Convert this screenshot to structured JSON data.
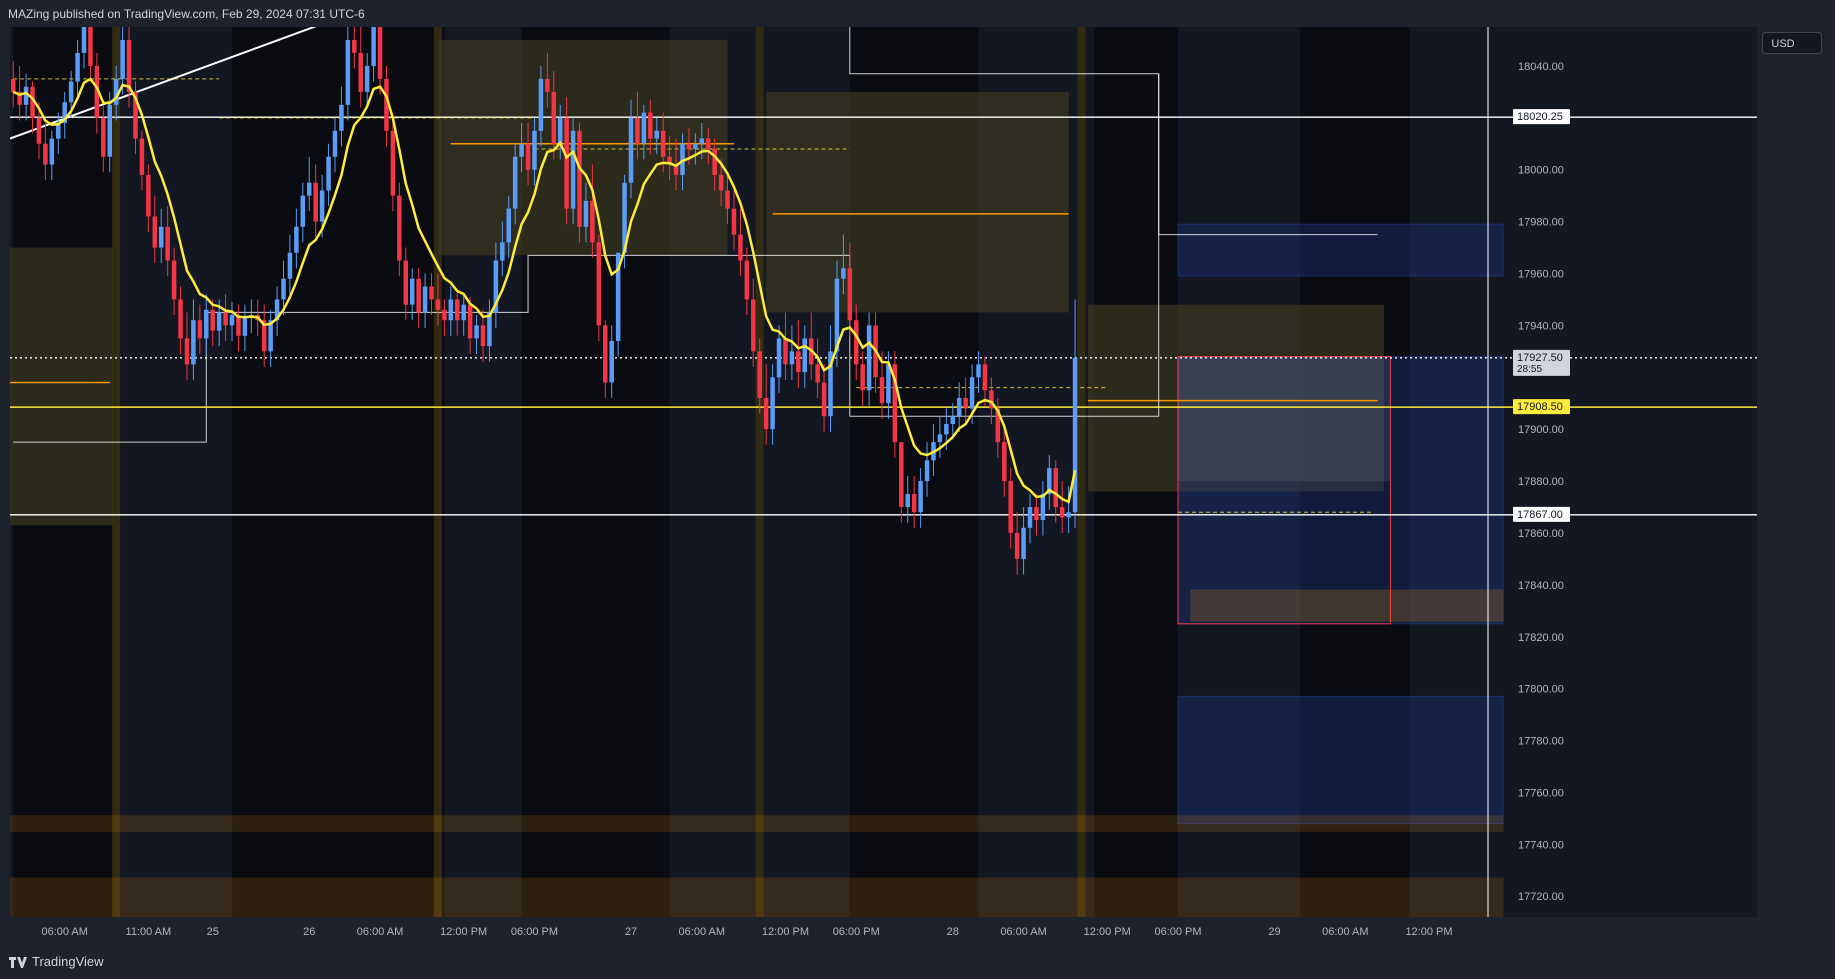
{
  "header": {
    "publish_line": "MAZing published on TradingView.com, Feb 29, 2024 07:31 UTC-6"
  },
  "footer": {
    "brand": "TradingView"
  },
  "currency_button": "USD",
  "colors": {
    "bull": "#5b9cf6",
    "bear": "#f23645",
    "ema": "#ffeb3b",
    "orange": "#ff9800",
    "zone_tan": "#3a3820",
    "session_band": "#3b3212",
    "blue_zone": "#1e3a8a",
    "bg": "#131722"
  },
  "chart_data": {
    "type": "candlestick",
    "symbol_currency": "USD",
    "ylim": [
      17712,
      18055
    ],
    "y_ticks": [
      18040,
      18020,
      18000,
      17980,
      17960,
      17940,
      17920,
      17900,
      17880,
      17860,
      17840,
      17820,
      17800,
      17780,
      17760,
      17740,
      17720
    ],
    "y_tick_labels": [
      "18040.00",
      "18000.00",
      "17980.00",
      "17960.00",
      "17940.00",
      "17900.00",
      "17880.00",
      "17860.00",
      "17840.00",
      "17820.00",
      "17800.00",
      "17780.00",
      "17760.00",
      "17740.00",
      "17720.00"
    ],
    "price_labels": [
      {
        "text": "18020.25",
        "value": 18020.25,
        "style": "white"
      },
      {
        "text": "17927.50",
        "sub": "28:55",
        "value": 17927.5,
        "style": "grey"
      },
      {
        "text": "17908.50",
        "value": 17908.5,
        "style": "yellow"
      },
      {
        "text": "17867.00",
        "value": 17867,
        "style": "white"
      }
    ],
    "x_labels": [
      "06:00 AM",
      "11:00 AM",
      "25",
      "26",
      "06:00 AM",
      "12:00 PM",
      "06:00 PM",
      "27",
      "06:00 AM",
      "12:00 PM",
      "06:00 PM",
      "28",
      "06:00 AM",
      "12:00 PM",
      "06:00 PM",
      "29",
      "06:00 AM",
      "12:00 PM"
    ],
    "x_label_index": [
      8,
      21,
      31,
      46,
      57,
      70,
      81,
      96,
      107,
      120,
      131,
      146,
      157,
      170,
      181,
      196,
      207,
      220
    ],
    "x_count": 232,
    "bars": [
      {
        "o": 18035,
        "h": 18042,
        "c": 18030
      },
      {
        "o": 18030,
        "h": 18040,
        "c": 18025
      },
      {
        "o": 18025,
        "h": 18037,
        "c": 18032
      },
      {
        "o": 18032,
        "h": 18034,
        "c": 18020
      },
      {
        "o": 18020,
        "h": 18026,
        "c": 18010
      },
      {
        "o": 18010,
        "h": 18018,
        "c": 18002
      },
      {
        "o": 18002,
        "h": 18015,
        "c": 18012
      },
      {
        "o": 18012,
        "h": 18022,
        "c": 18018
      },
      {
        "o": 18018,
        "h": 18030,
        "c": 18026
      },
      {
        "o": 18026,
        "h": 18038,
        "c": 18034
      },
      {
        "o": 18034,
        "h": 18050,
        "c": 18045
      },
      {
        "o": 18045,
        "h": 18060,
        "c": 18055
      },
      {
        "o": 18055,
        "h": 18058,
        "c": 18040
      },
      {
        "o": 18040,
        "h": 18045,
        "c": 18020
      },
      {
        "o": 18020,
        "h": 18025,
        "c": 18005
      },
      {
        "o": 18005,
        "h": 18030,
        "c": 18025
      },
      {
        "o": 18025,
        "h": 18040,
        "c": 18035
      },
      {
        "o": 18035,
        "h": 18058,
        "c": 18050
      },
      {
        "o": 18050,
        "h": 18056,
        "c": 18030
      },
      {
        "o": 18030,
        "h": 18034,
        "c": 18012
      },
      {
        "o": 18012,
        "h": 18015,
        "c": 17998
      },
      {
        "o": 17998,
        "h": 18002,
        "c": 17982
      },
      {
        "o": 17982,
        "h": 17990,
        "c": 17970
      },
      {
        "o": 17970,
        "h": 17985,
        "c": 17978
      },
      {
        "o": 17978,
        "h": 17986,
        "c": 17965
      },
      {
        "o": 17965,
        "h": 17970,
        "c": 17950
      },
      {
        "o": 17950,
        "h": 17955,
        "c": 17935
      },
      {
        "o": 17935,
        "h": 17945,
        "c": 17925
      },
      {
        "o": 17925,
        "h": 17950,
        "c": 17942
      },
      {
        "o": 17942,
        "h": 17948,
        "c": 17935
      },
      {
        "o": 17935,
        "h": 17952,
        "c": 17946
      },
      {
        "o": 17946,
        "h": 17950,
        "c": 17938
      },
      {
        "o": 17938,
        "h": 17950,
        "c": 17945
      },
      {
        "o": 17945,
        "h": 17952,
        "c": 17940
      },
      {
        "o": 17940,
        "h": 17949,
        "c": 17944
      },
      {
        "o": 17944,
        "h": 17948,
        "c": 17936
      },
      {
        "o": 17936,
        "h": 17948,
        "c": 17943
      },
      {
        "o": 17943,
        "h": 17950,
        "c": 17944
      },
      {
        "o": 17944,
        "h": 17950,
        "c": 17942
      },
      {
        "o": 17942,
        "h": 17948,
        "c": 17930
      },
      {
        "o": 17930,
        "h": 17946,
        "c": 17942
      },
      {
        "o": 17942,
        "h": 17955,
        "c": 17950
      },
      {
        "o": 17950,
        "h": 17965,
        "c": 17958
      },
      {
        "o": 17958,
        "h": 17975,
        "c": 17968
      },
      {
        "o": 17968,
        "h": 17985,
        "c": 17978
      },
      {
        "o": 17978,
        "h": 17995,
        "c": 17990
      },
      {
        "o": 17990,
        "h": 18005,
        "c": 17995
      },
      {
        "o": 17995,
        "h": 18002,
        "c": 17980
      },
      {
        "o": 17980,
        "h": 17998,
        "c": 17992
      },
      {
        "o": 17992,
        "h": 18010,
        "c": 18005
      },
      {
        "o": 18005,
        "h": 18020,
        "c": 18015
      },
      {
        "o": 18015,
        "h": 18032,
        "c": 18025
      },
      {
        "o": 18025,
        "h": 18055,
        "c": 18050
      },
      {
        "o": 18050,
        "h": 18062,
        "c": 18045
      },
      {
        "o": 18045,
        "h": 18058,
        "c": 18030
      },
      {
        "o": 18030,
        "h": 18045,
        "c": 18040
      },
      {
        "o": 18040,
        "h": 18062,
        "c": 18055
      },
      {
        "o": 18055,
        "h": 18062,
        "c": 18035
      },
      {
        "o": 18035,
        "h": 18040,
        "c": 18015
      },
      {
        "o": 18015,
        "h": 18020,
        "c": 17990
      },
      {
        "o": 17990,
        "h": 17995,
        "c": 17965
      },
      {
        "o": 17965,
        "h": 17970,
        "c": 17948
      },
      {
        "o": 17948,
        "h": 17962,
        "c": 17958
      },
      {
        "o": 17958,
        "h": 17962,
        "c": 17945
      },
      {
        "o": 17945,
        "h": 17960,
        "c": 17955
      },
      {
        "o": 17955,
        "h": 17960,
        "c": 17950
      },
      {
        "o": 17950,
        "h": 17960,
        "c": 17946
      },
      {
        "o": 17946,
        "h": 17950,
        "c": 17942
      },
      {
        "o": 17942,
        "h": 17955,
        "c": 17950
      },
      {
        "o": 17950,
        "h": 17953,
        "c": 17942
      },
      {
        "o": 17942,
        "h": 17952,
        "c": 17948
      },
      {
        "o": 17948,
        "h": 17951,
        "c": 17935
      },
      {
        "o": 17935,
        "h": 17944,
        "c": 17940
      },
      {
        "o": 17940,
        "h": 17946,
        "c": 17932
      },
      {
        "o": 17932,
        "h": 17950,
        "c": 17945
      },
      {
        "o": 17945,
        "h": 17972,
        "c": 17965
      },
      {
        "o": 17965,
        "h": 17980,
        "c": 17972
      },
      {
        "o": 17972,
        "h": 17990,
        "c": 17985
      },
      {
        "o": 17985,
        "h": 18010,
        "c": 18005
      },
      {
        "o": 18005,
        "h": 18018,
        "c": 18010
      },
      {
        "o": 18010,
        "h": 18018,
        "c": 18000
      },
      {
        "o": 18000,
        "h": 18020,
        "c": 18015
      },
      {
        "o": 18015,
        "h": 18040,
        "c": 18035
      },
      {
        "o": 18035,
        "h": 18045,
        "c": 18030
      },
      {
        "o": 18030,
        "h": 18038,
        "c": 18010
      },
      {
        "o": 18010,
        "h": 18025,
        "c": 18020
      },
      {
        "o": 18020,
        "h": 18028,
        "c": 17985
      },
      {
        "o": 17985,
        "h": 18020,
        "c": 18015
      },
      {
        "o": 18015,
        "h": 18018,
        "c": 17978
      },
      {
        "o": 17978,
        "h": 17995,
        "c": 17988
      },
      {
        "o": 17988,
        "h": 18002,
        "c": 17972
      },
      {
        "o": 17972,
        "h": 17975,
        "c": 17940
      },
      {
        "o": 17940,
        "h": 17942,
        "c": 17918
      },
      {
        "o": 17918,
        "h": 17940,
        "c": 17934
      },
      {
        "o": 17934,
        "h": 17960,
        "c": 17968
      },
      {
        "o": 17968,
        "h": 17998,
        "c": 17995
      },
      {
        "o": 17995,
        "h": 18027,
        "c": 18020
      },
      {
        "o": 18020,
        "h": 18030,
        "c": 18010
      },
      {
        "o": 18010,
        "h": 18025,
        "c": 18022
      },
      {
        "o": 18022,
        "h": 18027,
        "c": 18012
      },
      {
        "o": 18012,
        "h": 18020,
        "c": 18015
      },
      {
        "o": 18015,
        "h": 18022,
        "c": 18005
      },
      {
        "o": 18005,
        "h": 18013,
        "c": 18002
      },
      {
        "o": 18002,
        "h": 18012,
        "c": 17998
      },
      {
        "o": 17998,
        "h": 18014,
        "c": 18010
      },
      {
        "o": 18010,
        "h": 18016,
        "c": 18008
      },
      {
        "o": 18008,
        "h": 18014,
        "c": 18010
      },
      {
        "o": 18010,
        "h": 18018,
        "c": 18012
      },
      {
        "o": 18012,
        "h": 18016,
        "c": 18008
      },
      {
        "o": 18008,
        "h": 18012,
        "c": 17998
      },
      {
        "o": 17998,
        "h": 18004,
        "c": 17992
      },
      {
        "o": 17992,
        "h": 17998,
        "c": 17985
      },
      {
        "o": 17985,
        "h": 17992,
        "c": 17975
      },
      {
        "o": 17975,
        "h": 17985,
        "c": 17965
      },
      {
        "o": 17965,
        "h": 17970,
        "c": 17950
      },
      {
        "o": 17950,
        "h": 17958,
        "c": 17930
      },
      {
        "o": 17930,
        "h": 17935,
        "c": 17912
      },
      {
        "o": 17912,
        "h": 17925,
        "c": 17900
      },
      {
        "o": 17900,
        "h": 17925,
        "c": 17920
      },
      {
        "o": 17920,
        "h": 17940,
        "c": 17935
      },
      {
        "o": 17935,
        "h": 17945,
        "c": 17925
      },
      {
        "o": 17925,
        "h": 17940,
        "c": 17930
      },
      {
        "o": 17930,
        "h": 17942,
        "c": 17922
      },
      {
        "o": 17922,
        "h": 17940,
        "c": 17935
      },
      {
        "o": 17935,
        "h": 17945,
        "c": 17925
      },
      {
        "o": 17925,
        "h": 17935,
        "c": 17918
      },
      {
        "o": 17918,
        "h": 17925,
        "c": 17905
      },
      {
        "o": 17905,
        "h": 17940,
        "c": 17930
      },
      {
        "o": 17930,
        "h": 17965,
        "c": 17958
      },
      {
        "o": 17958,
        "h": 17975,
        "c": 17962
      },
      {
        "o": 17962,
        "h": 17972,
        "c": 17942
      },
      {
        "o": 17942,
        "h": 17948,
        "c": 17925
      },
      {
        "o": 17925,
        "h": 17930,
        "c": 17915
      },
      {
        "o": 17915,
        "h": 17945,
        "c": 17940
      },
      {
        "o": 17940,
        "h": 17945,
        "c": 17920
      },
      {
        "o": 17920,
        "h": 17930,
        "c": 17910
      },
      {
        "o": 17910,
        "h": 17930,
        "c": 17925
      },
      {
        "o": 17925,
        "h": 17930,
        "c": 17895
      },
      {
        "o": 17895,
        "h": 17888,
        "c": 17870
      },
      {
        "o": 17870,
        "h": 17882,
        "c": 17875
      },
      {
        "o": 17875,
        "h": 17882,
        "c": 17868
      },
      {
        "o": 17868,
        "h": 17885,
        "c": 17880
      },
      {
        "o": 17880,
        "h": 17895,
        "c": 17888
      },
      {
        "o": 17888,
        "h": 17902,
        "c": 17895
      },
      {
        "o": 17895,
        "h": 17905,
        "c": 17898
      },
      {
        "o": 17898,
        "h": 17908,
        "c": 17902
      },
      {
        "o": 17902,
        "h": 17910,
        "c": 17905
      },
      {
        "o": 17905,
        "h": 17918,
        "c": 17912
      },
      {
        "o": 17912,
        "h": 17920,
        "c": 17908
      },
      {
        "o": 17908,
        "h": 17925,
        "c": 17920
      },
      {
        "o": 17920,
        "h": 17930,
        "c": 17925
      },
      {
        "o": 17925,
        "h": 17928,
        "c": 17915
      },
      {
        "o": 17915,
        "h": 17920,
        "c": 17908
      },
      {
        "o": 17908,
        "h": 17912,
        "c": 17895
      },
      {
        "o": 17895,
        "h": 17900,
        "c": 17880
      },
      {
        "o": 17880,
        "h": 17885,
        "c": 17860
      },
      {
        "o": 17860,
        "h": 17868,
        "c": 17850
      },
      {
        "o": 17850,
        "h": 17870,
        "c": 17862
      },
      {
        "o": 17862,
        "h": 17875,
        "c": 17870
      },
      {
        "o": 17870,
        "h": 17875,
        "c": 17865
      },
      {
        "o": 17865,
        "h": 17880,
        "c": 17875
      },
      {
        "o": 17875,
        "h": 17890,
        "c": 17885
      },
      {
        "o": 17885,
        "h": 17888,
        "c": 17870
      },
      {
        "o": 17870,
        "h": 17880,
        "c": 17866
      },
      {
        "o": 17866,
        "h": 17878,
        "c": 17868
      },
      {
        "o": 17868,
        "h": 17950,
        "c": 17927.5
      }
    ],
    "ema_color": "#ffeb3b",
    "horizontal_levels": [
      {
        "value": 18020.25,
        "color": "#ffffff",
        "label": "18020.25"
      },
      {
        "value": 17927.5,
        "color": "#ffffff",
        "style": "dotted"
      },
      {
        "value": 17908.5,
        "color": "#ffeb3b"
      },
      {
        "value": 17867.0,
        "color": "#ffffff"
      }
    ]
  }
}
